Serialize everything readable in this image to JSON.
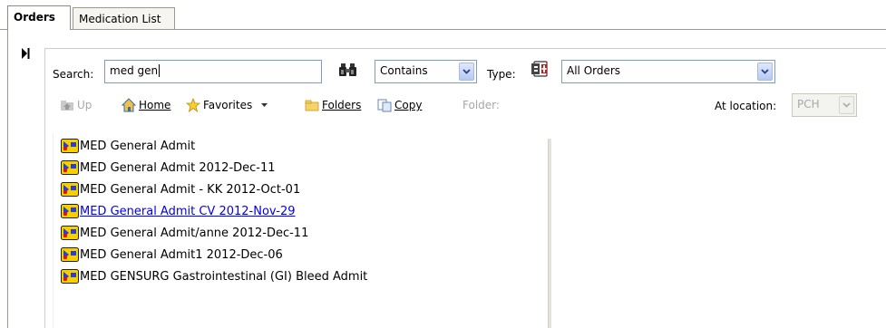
{
  "tabs": [
    {
      "label": "Orders",
      "active": true
    },
    {
      "label": "Medication List",
      "active": false
    }
  ],
  "search": {
    "label": "Search:",
    "value": "med gen",
    "match_mode": "Contains",
    "type_label": "Type:",
    "type_value": "All Orders"
  },
  "toolbar": {
    "up_label": "Up",
    "home_label": "Home",
    "favorites_label": "Favorites",
    "folders_label": "Folders",
    "copy_label": "Copy",
    "folder_label": "Folder:",
    "at_location_label": "At location:",
    "location_value": "PCH"
  },
  "results": [
    {
      "label": "MED General Admit"
    },
    {
      "label": "MED General Admit  2012-Dec-11"
    },
    {
      "label": "MED General Admit - KK  2012-Oct-01"
    },
    {
      "label": "MED General Admit CV  2012-Nov-29",
      "link": true
    },
    {
      "label": "MED General Admit/anne  2012-Dec-11"
    },
    {
      "label": "MED General Admit1  2012-Dec-06"
    },
    {
      "label": "MED GENSURG Gastrointestinal (GI) Bleed Admit"
    }
  ],
  "colors": {
    "link": "#0000ee",
    "field_border": "#7f9db9",
    "icon_yellow": "#f4d000",
    "icon_blue": "#2a3fd0",
    "icon_red": "#e01010"
  }
}
